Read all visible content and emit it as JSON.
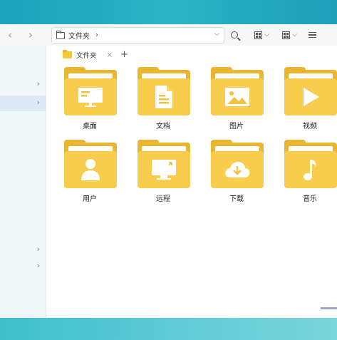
{
  "toolbar": {
    "back_glyph": "‹",
    "forward_glyph": "›",
    "path": "文件夹",
    "path_chevron": "›",
    "dropdown_glyph": "⌵"
  },
  "tab": {
    "label": "文件夹",
    "close_glyph": "×",
    "new_tab_glyph": "+"
  },
  "sidebar": {
    "chevron": "›",
    "bottom_text": "..."
  },
  "folders": [
    {
      "label": "桌面",
      "icon": "desktop-icon"
    },
    {
      "label": "文档",
      "icon": "document-icon"
    },
    {
      "label": "图片",
      "icon": "picture-icon"
    },
    {
      "label": "视频",
      "icon": "video-icon"
    },
    {
      "label": "用户",
      "icon": "user-icon"
    },
    {
      "label": "远程",
      "icon": "remote-icon"
    },
    {
      "label": "下载",
      "icon": "download-icon"
    },
    {
      "label": "音乐",
      "icon": "music-icon"
    }
  ],
  "colors": {
    "folder_front": "#f8cc4c",
    "folder_back": "#eab530",
    "desktop_bg": "#2fb6c8"
  }
}
